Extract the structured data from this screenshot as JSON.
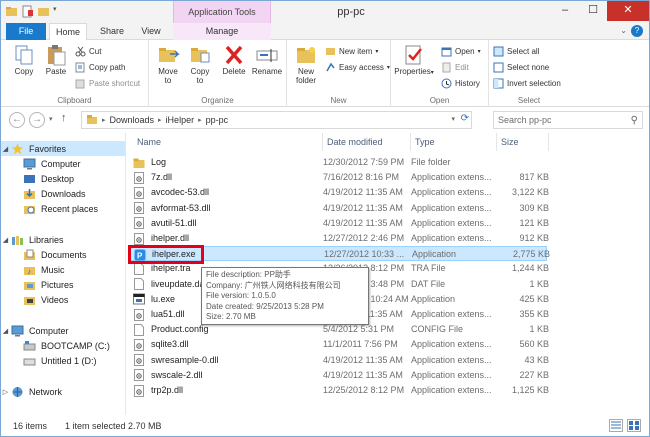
{
  "window": {
    "title": "pp-pc",
    "context_tab_group": "Application Tools",
    "minimize": "–",
    "maximize": "☐",
    "close": "✕"
  },
  "tabs": [
    "File",
    "Home",
    "Share",
    "View",
    "Manage"
  ],
  "ribbon": {
    "clipboard": {
      "label": "Clipboard",
      "copy": "Copy",
      "paste": "Paste",
      "cut": "Cut",
      "copy_path": "Copy path",
      "paste_shortcut": "Paste shortcut"
    },
    "organize": {
      "label": "Organize",
      "move_to": [
        "Move",
        "to"
      ],
      "copy_to": [
        "Copy",
        "to"
      ],
      "delete": "Delete",
      "rename": "Rename"
    },
    "new": {
      "label": "New",
      "new_folder": [
        "New",
        "folder"
      ],
      "new_item": "New item",
      "easy_access": "Easy access"
    },
    "open": {
      "label": "Open",
      "properties": "Properties",
      "open": "Open",
      "edit": "Edit",
      "history": "History"
    },
    "select": {
      "label": "Select",
      "select_all": "Select all",
      "select_none": "Select none",
      "invert_selection": "Invert selection"
    }
  },
  "address": {
    "crumbs": [
      "Downloads",
      "iHelper",
      "pp-pc"
    ],
    "search_placeholder": "Search pp-pc"
  },
  "nav": {
    "favorites": "Favorites",
    "favorites_items": [
      "Computer",
      "Desktop",
      "Downloads",
      "Recent places"
    ],
    "libraries": "Libraries",
    "libraries_items": [
      "Documents",
      "Music",
      "Pictures",
      "Videos"
    ],
    "computer": "Computer",
    "computer_items": [
      "BOOTCAMP (C:)",
      "Untitled 1 (D:)"
    ],
    "network": "Network"
  },
  "columns": [
    "Name",
    "Date modified",
    "Type",
    "Size"
  ],
  "files": [
    {
      "name": "Log",
      "date": "12/30/2012 7:59 PM",
      "type": "File folder",
      "size": "",
      "icon": "folder"
    },
    {
      "name": "7z.dll",
      "date": "7/16/2012 8:16 PM",
      "type": "Application extens...",
      "size": "817 KB",
      "icon": "dll"
    },
    {
      "name": "avcodec-53.dll",
      "date": "4/19/2012 11:35 AM",
      "type": "Application extens...",
      "size": "3,122 KB",
      "icon": "dll"
    },
    {
      "name": "avformat-53.dll",
      "date": "4/19/2012 11:35 AM",
      "type": "Application extens...",
      "size": "309 KB",
      "icon": "dll"
    },
    {
      "name": "avutil-51.dll",
      "date": "4/19/2012 11:35 AM",
      "type": "Application extens...",
      "size": "121 KB",
      "icon": "dll"
    },
    {
      "name": "ihelper.dll",
      "date": "12/27/2012 2:46 PM",
      "type": "Application extens...",
      "size": "912 KB",
      "icon": "dll"
    },
    {
      "name": "ihelper.exe",
      "date": "12/27/2012 10:33 ...",
      "type": "Application",
      "size": "2,775 KB",
      "icon": "pp",
      "selected": true
    },
    {
      "name": "ihelper.tra",
      "date": "12/26/2012 8:12 PM",
      "type": "TRA File",
      "size": "1,244 KB",
      "icon": "file"
    },
    {
      "name": "liveupdate.dat",
      "date": "12/27/2012 3:48 PM",
      "type": "DAT File",
      "size": "1 KB",
      "icon": "file"
    },
    {
      "name": "lu.exe",
      "date": "12/27/2012 10:24 AM",
      "type": "Application",
      "size": "425 KB",
      "icon": "exe"
    },
    {
      "name": "lua51.dll",
      "date": "4/19/2012 11:35 AM",
      "type": "Application extens...",
      "size": "355 KB",
      "icon": "dll"
    },
    {
      "name": "Product.config",
      "date": "5/4/2012 5:31 PM",
      "type": "CONFIG File",
      "size": "1 KB",
      "icon": "file"
    },
    {
      "name": "sqlite3.dll",
      "date": "11/1/2011 7:56 PM",
      "type": "Application extens...",
      "size": "560 KB",
      "icon": "dll"
    },
    {
      "name": "swresample-0.dll",
      "date": "4/19/2012 11:35 AM",
      "type": "Application extens...",
      "size": "43 KB",
      "icon": "dll"
    },
    {
      "name": "swscale-2.dll",
      "date": "4/19/2012 11:35 AM",
      "type": "Application extens...",
      "size": "227 KB",
      "icon": "dll"
    },
    {
      "name": "trp2p.dll",
      "date": "12/25/2012 8:12 PM",
      "type": "Application extens...",
      "size": "1,125 KB",
      "icon": "dll"
    }
  ],
  "tooltip": {
    "description": "File description: PP助手",
    "company": "Company: 广州铁人网络科技有限公司",
    "version": "File version: 1.0.5.0",
    "created": "Date created: 9/25/2013 5:28 PM",
    "size": "Size: 2.70 MB"
  },
  "status": {
    "items": "16 items",
    "selected": "1 item selected  2.70 MB"
  },
  "colors": {
    "accent": "#1979ca",
    "selection": "#cce8ff",
    "highlight": "#e3001b",
    "folder": "#e8c15a"
  }
}
